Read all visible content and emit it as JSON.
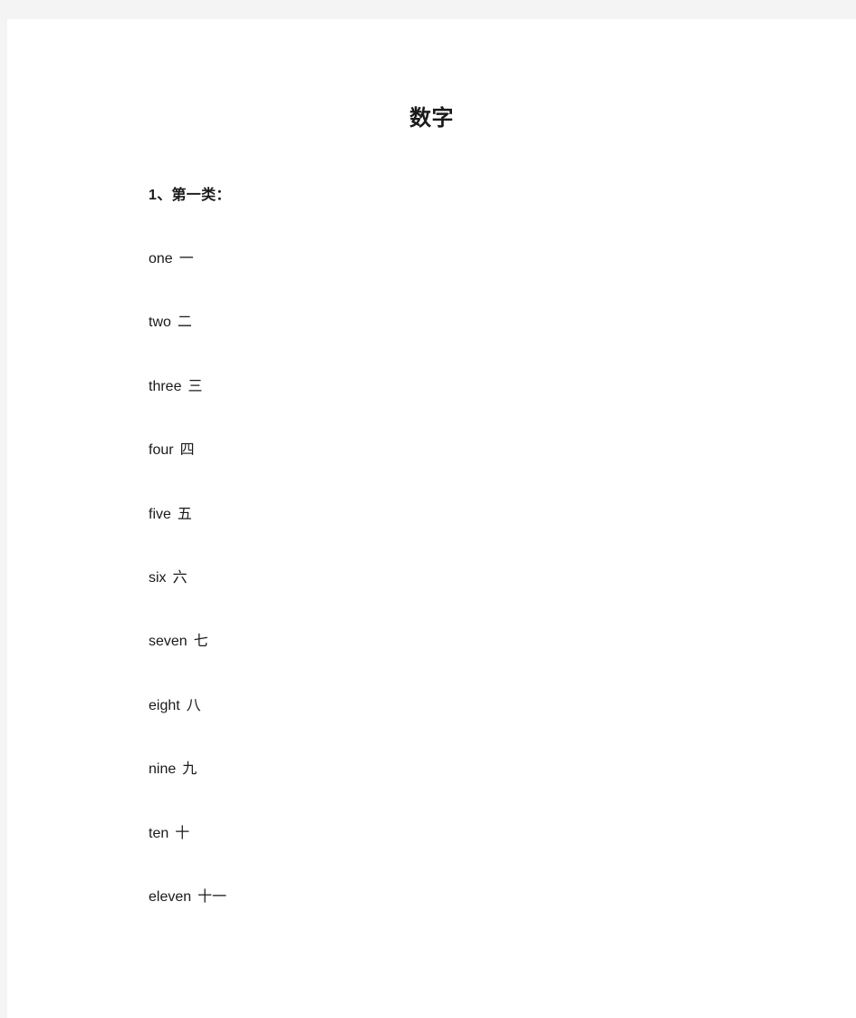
{
  "document": {
    "title": "数字",
    "background_color": "#f4f4f4",
    "page_color": "#ffffff",
    "text_color": "#1a1a1a",
    "sections": [
      {
        "heading": "1、第一类：",
        "entries": [
          {
            "english": "one",
            "chinese": "一"
          },
          {
            "english": "two",
            "chinese": "二"
          },
          {
            "english": "three",
            "chinese": "三"
          },
          {
            "english": "four",
            "chinese": "四"
          },
          {
            "english": "five",
            "chinese": "五"
          },
          {
            "english": "six",
            "chinese": "六"
          },
          {
            "english": "seven",
            "chinese": "七"
          },
          {
            "english": "eight",
            "chinese": "八"
          },
          {
            "english": "nine",
            "chinese": "九"
          },
          {
            "english": "ten",
            "chinese": "十"
          },
          {
            "english": "eleven",
            "chinese": "十一"
          }
        ]
      }
    ]
  }
}
